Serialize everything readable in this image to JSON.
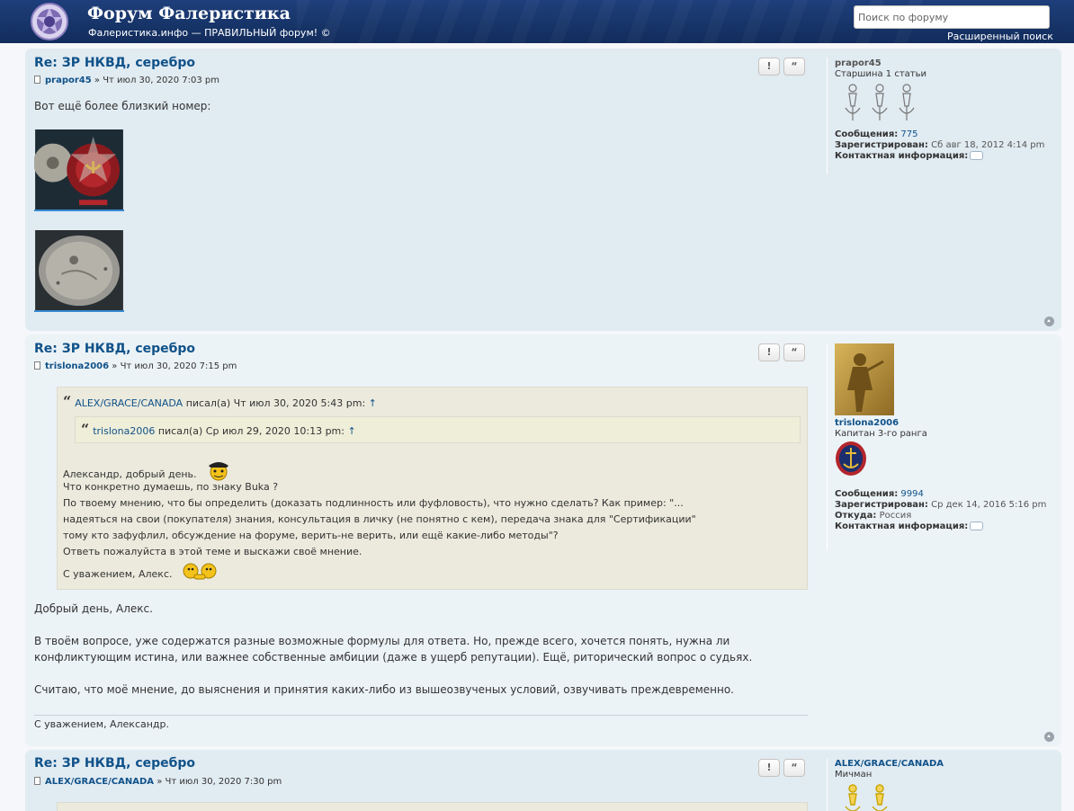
{
  "header": {
    "title": "Форум Фалеристика",
    "description": "Фалеристика.инфо — ПРАВИЛЬНЫЙ форум! ©",
    "search_placeholder": "Поиск по форуму",
    "advanced_search": "Расширенный поиск"
  },
  "buttons": {
    "report": "!",
    "quote": "“"
  },
  "labels": {
    "posts": "Сообщения:",
    "joined": "Зарегистрирован:",
    "location": "Откуда:",
    "contact": "Контактная информация:"
  },
  "posts": [
    {
      "title": "Re: ЗР НКВД, серебро",
      "author": "prapor45",
      "date": " » Чт июл 30, 2020 7:03 pm",
      "body": "Вот ещё более близкий номер:",
      "profile": {
        "username": "prapor45",
        "rank": "Старшина 1 статьи",
        "posts": "775",
        "joined": "Сб авг 18, 2012 4:14 pm"
      }
    },
    {
      "title": "Re: ЗР НКВД, серебро",
      "author": "trislona2006",
      "date": " » Чт июл 30, 2020 7:15 pm",
      "quote": {
        "author": "ALEX/GRACE/CANADA",
        "wrote": " писал(а) Чт июл 30, 2020 5:43 pm: ",
        "arrow": "↑",
        "inner_author": "trislona2006",
        "inner_wrote": " писал(а) Ср июл 29, 2020 10:13 pm: ",
        "lines": [
          "Александр, добрый день.",
          "Что конкретно думаешь, по знаку Buka ?",
          "По твоему мнению, что бы определить (доказать подлинность или фуфловость), что нужно сделать? Как пример: \"...",
          "надеяться на свои (покупателя) знания, консультация в личку (не понятно с кем), передача знака для \"Сертификации\"",
          "тому кто зафуфлил, обсуждение на форуме, верить-не верить, или ещё какие-либо методы\"?",
          "Ответь пожалуйста в этой теме и выскажи своё мнение."
        ],
        "closing": "С уважением, Алекс."
      },
      "body": [
        "Добрый день, Алекс.",
        "В твоём вопросе, уже содержатся разные возможные формулы для ответа. Но, прежде всего, хочется понять, нужна ли",
        "конфликтующим истина, или важнее собственные амбиции (даже в ущерб репутации). Ещё, риторический вопрос о судьях.",
        "Считаю, что моё мнение, до выяснения и принятия каких-либо из вышеозвученых условий, озвучивать преждевременно."
      ],
      "signature": "С уважением, Александр.",
      "profile": {
        "username": "trislona2006",
        "rank": "Капитан 3-го ранга",
        "posts": "9994",
        "joined": "Ср дек 14, 2016 5:16 pm",
        "location": "Россия"
      }
    },
    {
      "title": "Re: ЗР НКВД, серебро",
      "author": "ALEX/GRACE/CANADA",
      "date": " » Чт июл 30, 2020 7:30 pm",
      "profile": {
        "username": "ALEX/GRACE/CANADA",
        "rank": "Мичман"
      }
    }
  ],
  "colors": {
    "header": "#173569",
    "post_bg2": "#e1ebf2",
    "post_bg1": "#ecf3f7",
    "link": "#105289",
    "quote_bg": "#ebeadd"
  }
}
